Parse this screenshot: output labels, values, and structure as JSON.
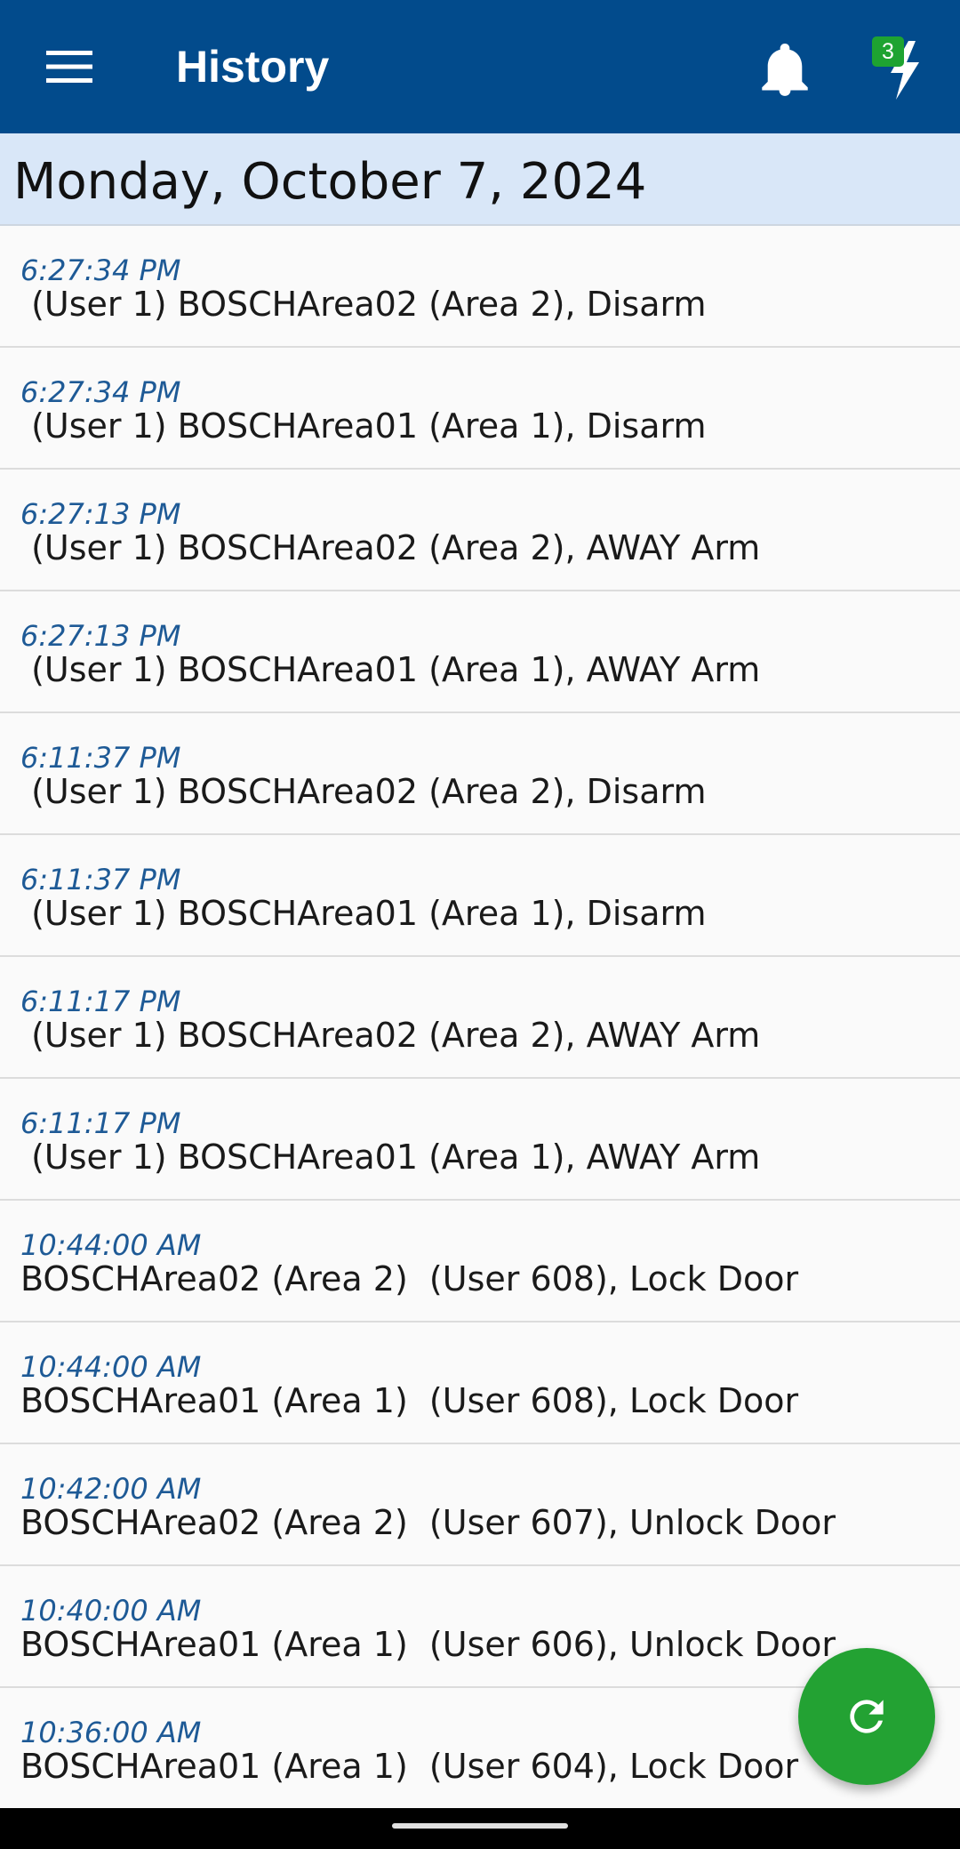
{
  "app_bar": {
    "title": "History",
    "menu_icon": "hamburger-menu-icon",
    "bell_icon": "bell-icon",
    "bolt_icon": "lightning-bolt-icon",
    "bolt_badge": "3",
    "background_color": "#024b8c",
    "badge_color": "#1ea331"
  },
  "date_header": {
    "text": "Monday, October 7, 2024",
    "background_color": "#d9e7f8"
  },
  "events": [
    {
      "time": "6:27:34 PM",
      "desc": " (User 1) BOSCHArea02 (Area 2), Disarm"
    },
    {
      "time": "6:27:34 PM",
      "desc": " (User 1) BOSCHArea01 (Area 1), Disarm"
    },
    {
      "time": "6:27:13 PM",
      "desc": " (User 1) BOSCHArea02 (Area 2), AWAY Arm"
    },
    {
      "time": "6:27:13 PM",
      "desc": " (User 1) BOSCHArea01 (Area 1), AWAY Arm"
    },
    {
      "time": "6:11:37 PM",
      "desc": " (User 1) BOSCHArea02 (Area 2), Disarm"
    },
    {
      "time": "6:11:37 PM",
      "desc": " (User 1) BOSCHArea01 (Area 1), Disarm"
    },
    {
      "time": "6:11:17 PM",
      "desc": " (User 1) BOSCHArea02 (Area 2), AWAY Arm"
    },
    {
      "time": "6:11:17 PM",
      "desc": " (User 1) BOSCHArea01 (Area 1), AWAY Arm"
    },
    {
      "time": "10:44:00 AM",
      "desc": "BOSCHArea02 (Area 2)  (User 608), Lock Door"
    },
    {
      "time": "10:44:00 AM",
      "desc": "BOSCHArea01 (Area 1)  (User 608), Lock Door"
    },
    {
      "time": "10:42:00 AM",
      "desc": "BOSCHArea02 (Area 2)  (User 607), Unlock Door"
    },
    {
      "time": "10:40:00 AM",
      "desc": "BOSCHArea01 (Area 1)  (User 606), Unlock Door"
    },
    {
      "time": "10:36:00 AM",
      "desc": "BOSCHArea01 (Area 1)  (User 604), Lock Door"
    }
  ],
  "fab": {
    "icon": "refresh-icon",
    "color": "#23a233"
  },
  "colors": {
    "time_text": "#1e5a96",
    "list_background": "#fafafa"
  }
}
